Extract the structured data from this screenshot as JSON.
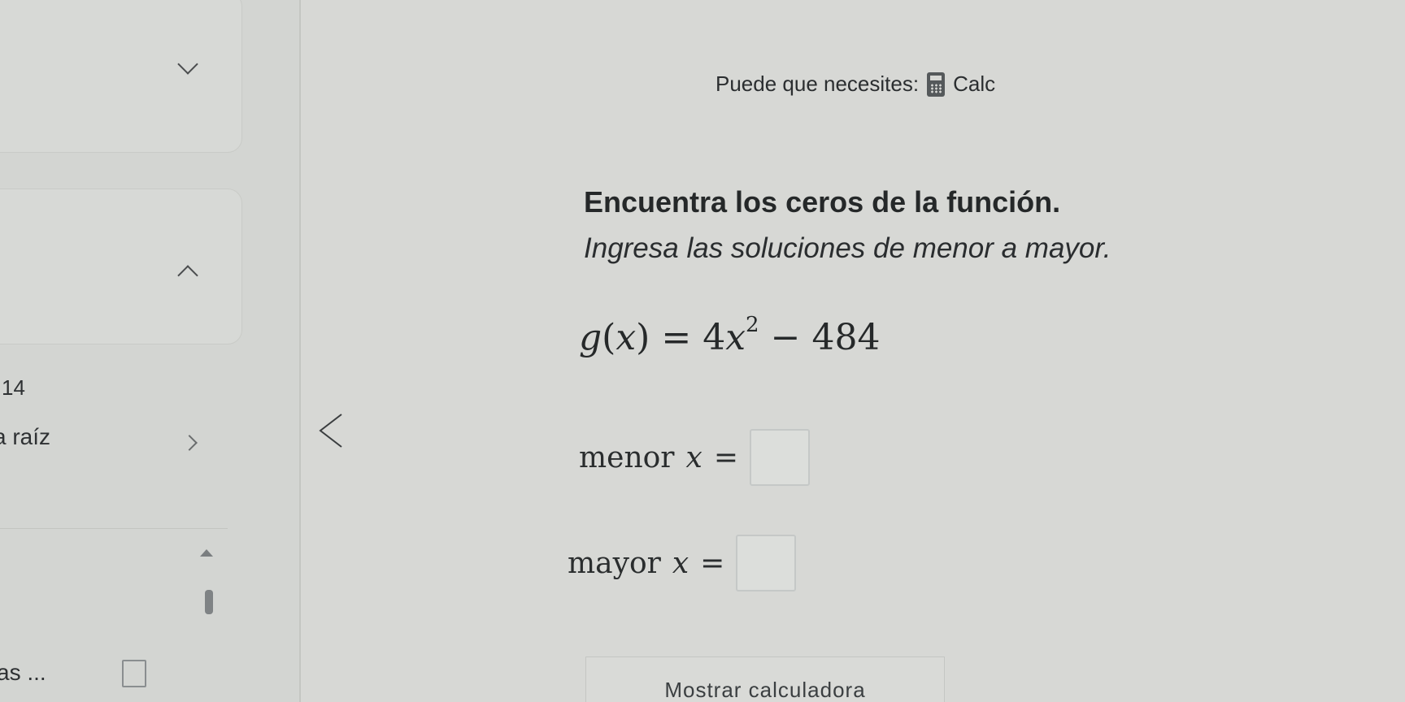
{
  "hint": {
    "label": "Puede que necesites:",
    "tool_label": "Calc",
    "icon": "calculator-icon"
  },
  "problem": {
    "title": "Encuentra los ceros de la función.",
    "instruction": "Ingresa las soluciones de menor a mayor.",
    "function_name": "g",
    "function_var": "x",
    "equals": "=",
    "coefficient": "4",
    "exponent": "2",
    "minus": "−",
    "constant": "484"
  },
  "answers": [
    {
      "label": "menor",
      "var": "x",
      "equals": "=",
      "value": ""
    },
    {
      "label": "mayor",
      "var": "x",
      "equals": "=",
      "value": ""
    }
  ],
  "sidebar": {
    "number": "14",
    "item_label": "a raíz",
    "bottom_label": "as ..."
  },
  "calculator_button": {
    "label": "Mostrar calculadora"
  }
}
